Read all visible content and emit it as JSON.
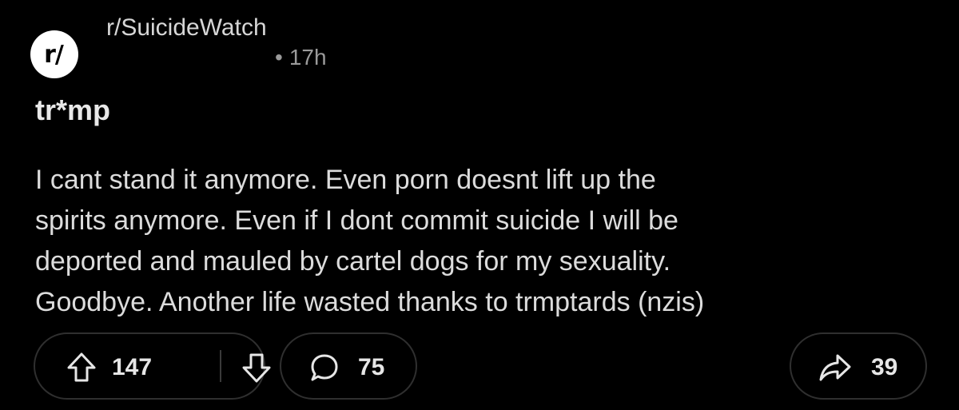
{
  "post": {
    "subreddit": "r/SuicideWatch",
    "avatar_text": "r/",
    "dot": "•",
    "time": "17h",
    "title": "tr*mp",
    "body_lines": [
      "I cant stand it anymore. Even porn doesnt lift up the",
      "spirits anymore. Even if I dont commit suicide I will be",
      "deported and mauled by cartel dogs for my sexuality.",
      "Goodbye. Another life wasted thanks to trmptards (nzis)"
    ]
  },
  "actions": {
    "upvotes": "147",
    "comments": "75",
    "shares": "39",
    "icons": {
      "upvote": "upvote-arrow-icon",
      "downvote": "downvote-arrow-icon",
      "comment": "comment-bubble-icon",
      "share": "share-arrow-icon"
    }
  },
  "colors": {
    "background": "#000000",
    "text": "#e8e8e8",
    "muted": "#9a9a9a",
    "pill_border": "#2f2f2f",
    "avatar_bg": "#ffffff"
  }
}
